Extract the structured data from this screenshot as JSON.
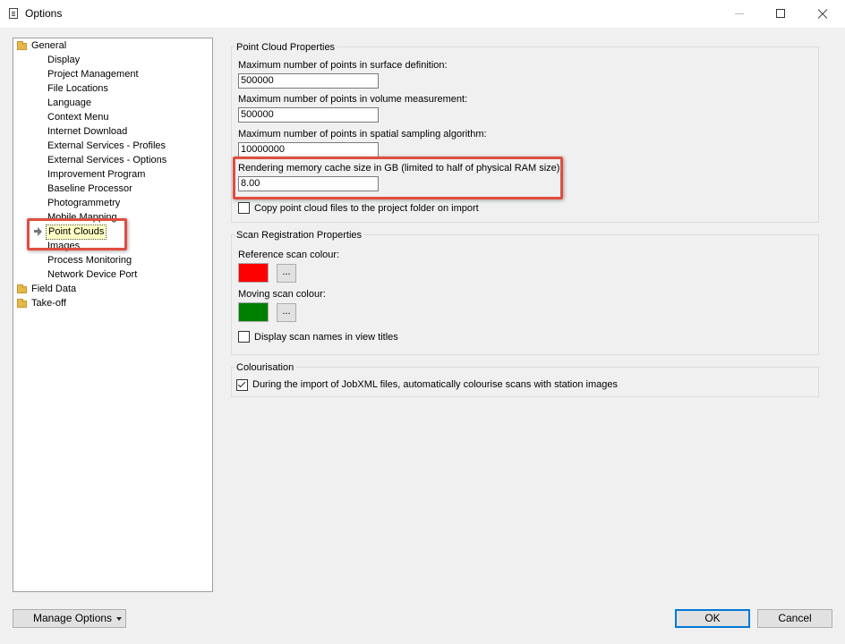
{
  "window": {
    "title": "Options",
    "icon": "options-app-icon"
  },
  "tree": {
    "general": "General",
    "general_children": [
      "Display",
      "Project Management",
      "File Locations",
      "Language",
      "Context Menu",
      "Internet Download",
      "External Services - Profiles",
      "External Services - Options",
      "Improvement Program",
      "Baseline Processor",
      "Photogrammetry",
      "Mobile Mapping",
      "Point Clouds",
      "Images",
      "Process Monitoring",
      "Network Device Port"
    ],
    "selected": "Point Clouds",
    "field_data": "Field Data",
    "take_off": "Take-off"
  },
  "point_cloud": {
    "title": "Point Cloud Properties",
    "surface_label": "Maximum number of points in surface definition:",
    "surface_value": "500000",
    "volume_label": "Maximum number of points in volume measurement:",
    "volume_value": "500000",
    "spatial_label": "Maximum number of points in spatial sampling algorithm:",
    "spatial_value": "10000000",
    "cache_label": "Rendering memory cache size in GB (limited to half of physical RAM size):",
    "cache_value": "8.00",
    "copy_label": "Copy point cloud files to the project folder on import",
    "copy_checked": false
  },
  "scan_registration": {
    "title": "Scan Registration Properties",
    "reference_label": "Reference scan colour:",
    "reference_color": "#ff0000",
    "moving_label": "Moving scan colour:",
    "moving_color": "#008000",
    "ellipsis": "...",
    "display_names_label": "Display scan names in view titles",
    "display_names_checked": false
  },
  "colourisation": {
    "title": "Colourisation",
    "auto_label": "During the import of JobXML files, automatically colourise scans with station images",
    "auto_checked": true
  },
  "footer": {
    "manage_options": "Manage Options",
    "ok": "OK",
    "cancel": "Cancel"
  },
  "highlight_color": "#e04e40"
}
